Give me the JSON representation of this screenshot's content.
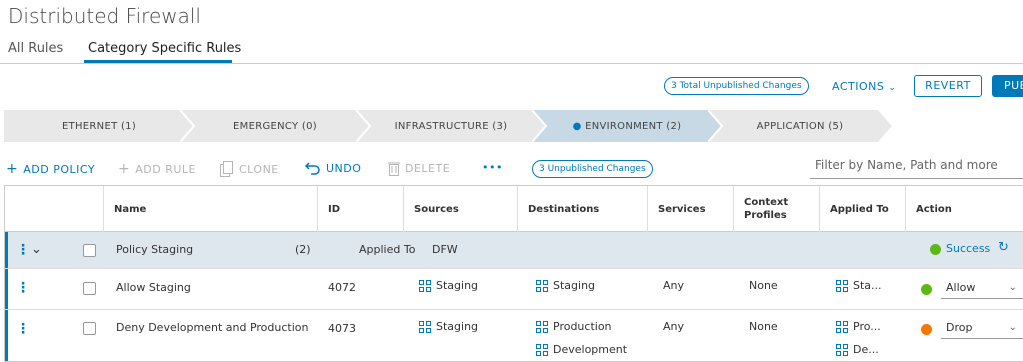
{
  "page": {
    "title": "Distributed Firewall"
  },
  "tabs": [
    "All Rules",
    "Category Specific Rules"
  ],
  "header": {
    "total_changes": "3 Total Unpublished Changes",
    "actions": "ACTIONS",
    "revert": "REVERT",
    "publish": "PUBLISH"
  },
  "categories": [
    "ETHERNET (1)",
    "EMERGENCY (0)",
    "INFRASTRUCTURE (3)",
    "ENVIRONMENT (2)",
    "APPLICATION (5)"
  ],
  "toolbar": {
    "add_policy": "ADD POLICY",
    "add_rule": "ADD RULE",
    "clone": "CLONE",
    "undo": "UNDO",
    "delete": "DELETE",
    "more": "•••",
    "unpublished": "3 Unpublished Changes",
    "filter_placeholder": "Filter by Name, Path and more"
  },
  "columns": [
    "Name",
    "ID",
    "Sources",
    "Destinations",
    "Services",
    "Context Profiles",
    "Applied To",
    "Action"
  ],
  "policy": {
    "name": "Policy Staging",
    "count": "(2)",
    "applied_label": "Applied To",
    "applied_value": "DFW",
    "status": "Success"
  },
  "rules": [
    {
      "name": "Allow Staging",
      "id": "4072",
      "sources": [
        "Staging"
      ],
      "destinations": [
        "Staging"
      ],
      "services": "Any",
      "profiles": "None",
      "applied": [
        "Sta..."
      ],
      "action": "Allow"
    },
    {
      "name": "Deny Development and Production",
      "id": "4073",
      "sources": [
        "Staging"
      ],
      "destinations": [
        "Production",
        "Development"
      ],
      "services": "Any",
      "profiles": "None",
      "applied": [
        "Pro...",
        "De..."
      ],
      "action": "Drop"
    }
  ],
  "colors": {
    "accent": "#0079b8",
    "allow": "#5eb715",
    "drop": "#f57600",
    "success": "#5eb715"
  }
}
